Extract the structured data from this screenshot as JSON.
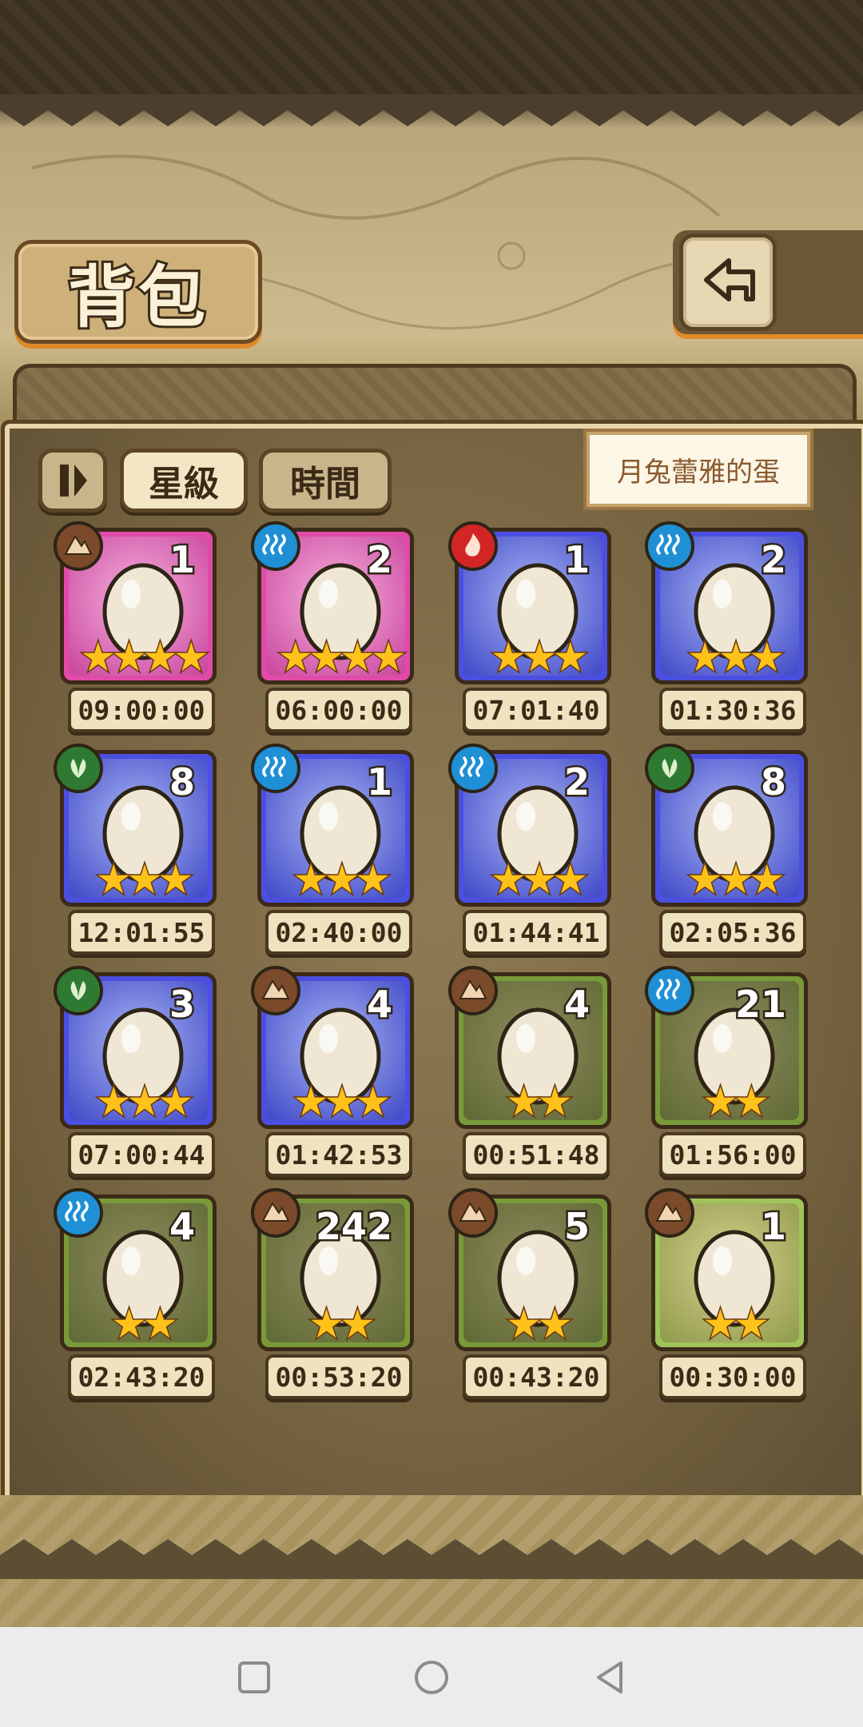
{
  "header": {
    "title": "背包",
    "back_icon": "return-arrow-icon"
  },
  "toolbar": {
    "pause_icon": "pause-icon",
    "sort_star_label": "星級",
    "sort_time_label": "時間",
    "selected_item_name": "月兔蕾雅的蛋"
  },
  "colors": {
    "star": "#ffc21a",
    "water": "#1f8fd6",
    "earth": "#7a4a2a",
    "fire": "#d22626",
    "grass": "#2f7a33"
  },
  "eggs": [
    {
      "element": "earth",
      "rarity": "pink",
      "count": "1",
      "stars": "★★★★",
      "timer": "09:00:00",
      "icon": "cracked-green-egg-icon"
    },
    {
      "element": "water",
      "rarity": "pink",
      "count": "2",
      "stars": "★★★★",
      "timer": "06:00:00",
      "icon": "purple-fish-egg-icon"
    },
    {
      "element": "fire",
      "rarity": "blue",
      "count": "1",
      "stars": "★★★",
      "timer": "07:01:40",
      "icon": "cactus-egg-icon"
    },
    {
      "element": "water",
      "rarity": "blue",
      "count": "2",
      "stars": "★★★",
      "timer": "01:30:36",
      "icon": "sailor-egg-icon"
    },
    {
      "element": "grass",
      "rarity": "blue",
      "count": "8",
      "stars": "★★★",
      "timer": "12:01:55",
      "icon": "leaf-egg-icon"
    },
    {
      "element": "water",
      "rarity": "blue",
      "count": "1",
      "stars": "★★★",
      "timer": "02:40:00",
      "icon": "crystal-egg-icon"
    },
    {
      "element": "water",
      "rarity": "blue",
      "count": "2",
      "stars": "★★★",
      "timer": "01:44:41",
      "icon": "cloud-egg-icon"
    },
    {
      "element": "grass",
      "rarity": "blue",
      "count": "8",
      "stars": "★★★",
      "timer": "02:05:36",
      "icon": "studded-egg-icon"
    },
    {
      "element": "grass",
      "rarity": "blue",
      "count": "3",
      "stars": "★★★",
      "timer": "07:00:44",
      "icon": "bud-egg-icon"
    },
    {
      "element": "earth",
      "rarity": "blue",
      "count": "4",
      "stars": "★★★",
      "timer": "01:42:53",
      "icon": "fluffy-egg-icon"
    },
    {
      "element": "earth",
      "rarity": "green",
      "count": "4",
      "stars": "★★",
      "timer": "00:51:48",
      "icon": "bandaged-egg-icon"
    },
    {
      "element": "water",
      "rarity": "green",
      "count": "21",
      "stars": "★★",
      "timer": "01:56:00",
      "icon": "drop-egg-icon"
    },
    {
      "element": "water",
      "rarity": "green",
      "count": "4",
      "stars": "★★",
      "timer": "02:43:20",
      "icon": "ice-rock-egg-icon"
    },
    {
      "element": "earth",
      "rarity": "green",
      "count": "242",
      "stars": "★★",
      "timer": "00:53:20",
      "icon": "rock-egg-icon"
    },
    {
      "element": "earth",
      "rarity": "green",
      "count": "5",
      "stars": "★★",
      "timer": "00:43:20",
      "icon": "spiral-egg-icon"
    },
    {
      "element": "earth",
      "rarity": "lightgreen",
      "count": "1",
      "stars": "★★",
      "timer": "00:30:00",
      "icon": "hat-egg-icon"
    }
  ],
  "system_nav": {
    "recent_icon": "square-icon",
    "home_icon": "circle-icon",
    "back_icon": "triangle-back-icon"
  }
}
